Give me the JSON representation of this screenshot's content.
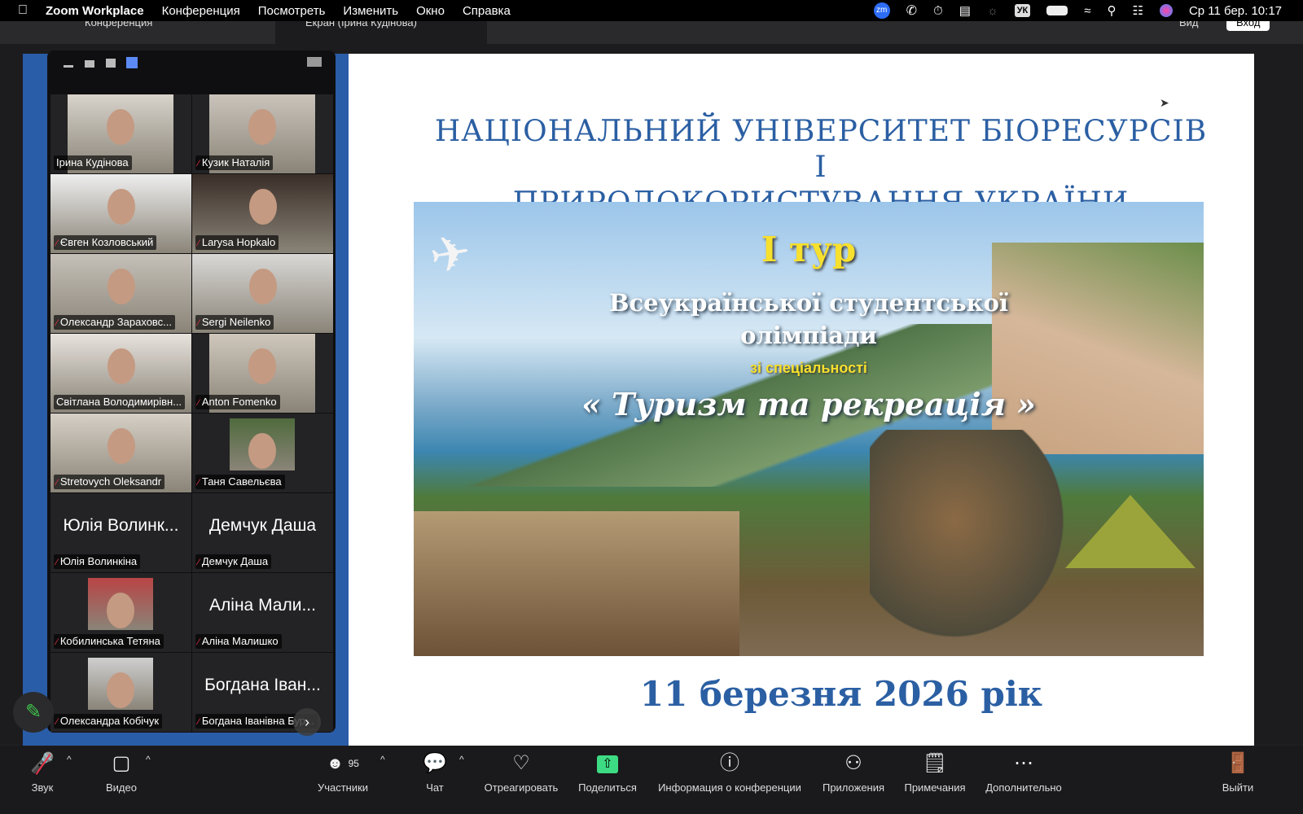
{
  "menubar": {
    "app": "Zoom Workplace",
    "items": [
      "Конференция",
      "Посмотреть",
      "Изменить",
      "Окно",
      "Справка"
    ],
    "keyboard": "УК",
    "clock": "Ср 11 бер.  10:17",
    "zoom_badge": "zm"
  },
  "window": {
    "tab1": "Конференция",
    "tab2": "Екран (Ірина  Кудінова)",
    "view": "Вид",
    "signin": "Вход"
  },
  "slide": {
    "title_line1": "НАЦІОНАЛЬНИЙ УНІВЕРСИТЕТ БІОРЕСУРСІВ І",
    "title_line2": "ПРИРОДОКОРИСТУВАННЯ УКРАЇНИ",
    "poster_round": "І тур",
    "poster_line1": "Всеукраїнської студентської",
    "poster_line2": "олімпіади",
    "poster_spec": "зі спеціальності",
    "poster_subject": "« Туризм та рекреація »",
    "date": "11 березня 2026 рік"
  },
  "participants": [
    {
      "name": "Ірина  Кудінова",
      "muted": false,
      "video": true
    },
    {
      "name": "Кузик Наталія",
      "muted": true,
      "video": true
    },
    {
      "name": "Євген Козловський",
      "muted": true,
      "video": true
    },
    {
      "name": "Larysa Hopkalo",
      "muted": true,
      "video": true
    },
    {
      "name": "Олександр Зараховс...",
      "muted": true,
      "video": true
    },
    {
      "name": "Sergi Neilenko",
      "muted": true,
      "video": true
    },
    {
      "name": "Світлана Володимирівн...",
      "muted": false,
      "video": true,
      "active": true
    },
    {
      "name": "Anton Fomenko",
      "muted": true,
      "video": true
    },
    {
      "name": "Stretovych Oleksandr",
      "muted": true,
      "video": true
    },
    {
      "name": "Таня Савельєва",
      "muted": true,
      "video": true
    },
    {
      "name": "Юлія Волинкіна",
      "big": "Юлія Волинк...",
      "muted": true,
      "video": false
    },
    {
      "name": "Демчук Даша",
      "big": "Демчук Даша",
      "muted": true,
      "video": false
    },
    {
      "name": "Кобилинська Тетяна",
      "muted": true,
      "video": true
    },
    {
      "name": "Аліна Малишко",
      "big": "Аліна Мали...",
      "muted": true,
      "video": false
    },
    {
      "name": "Олександра Кобічук",
      "muted": true,
      "video": true
    },
    {
      "name": "Богдана Іванівна Бур...",
      "big": "Богдана Іван...",
      "muted": true,
      "video": false
    }
  ],
  "toolbar": {
    "audio": "Звук",
    "video": "Видео",
    "participants": "Участники",
    "participants_count": "95",
    "chat": "Чат",
    "react": "Отреагировать",
    "share": "Поделиться",
    "info": "Информация о конференции",
    "apps": "Приложения",
    "notes": "Примечания",
    "more": "Дополнительно",
    "leave": "Выйти"
  },
  "colors": {
    "accent": "#2b5fa3",
    "share": "#3ddc84",
    "leave": "#e8334a",
    "active_speaker": "#3fc24a"
  }
}
